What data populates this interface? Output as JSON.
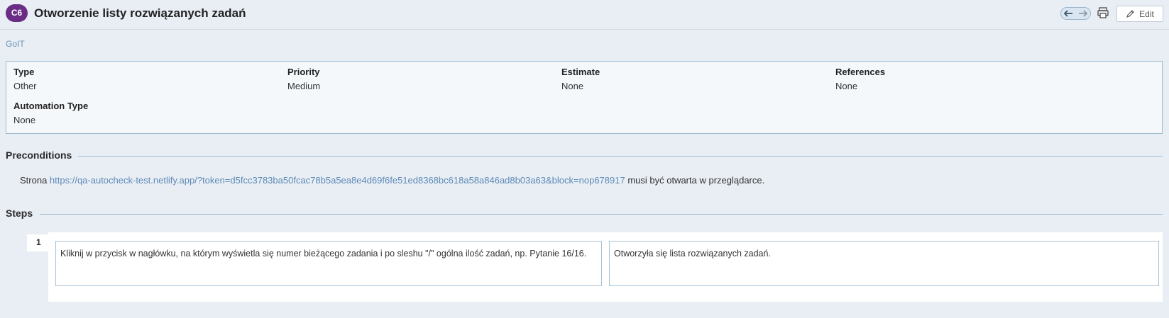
{
  "header": {
    "case_id": "C6",
    "title": "Otworzenie listy rozwiązanych zadań",
    "nav_prev": "🡐",
    "nav_next": "🡒",
    "edit_label": "Edit"
  },
  "breadcrumb": "GoIT",
  "properties": [
    {
      "label": "Type",
      "value": "Other"
    },
    {
      "label": "Priority",
      "value": "Medium"
    },
    {
      "label": "Estimate",
      "value": "None"
    },
    {
      "label": "References",
      "value": "None"
    },
    {
      "label": "Automation Type",
      "value": "None"
    }
  ],
  "preconditions": {
    "title": "Preconditions",
    "prefix": "Strona ",
    "link": "https://qa-autocheck-test.netlify.app/?token=d5fcc3783ba50fcac78b5a5ea8e4d69f6fe51ed8368bc618a58a846ad8b03a63&block=nop678917",
    "suffix": " musi być otwarta w przeglądarce."
  },
  "steps": {
    "title": "Steps",
    "items": [
      {
        "number": "1",
        "content": "Kliknij w przycisk w nagłówku, na którym wyświetla się numer bieżącego zadania i po sleshu \"/\" ogólna ilość zadań, np. Pytanie 16/16.",
        "expected": "Otworzyła się lista rozwiązanych zadań."
      }
    ]
  }
}
